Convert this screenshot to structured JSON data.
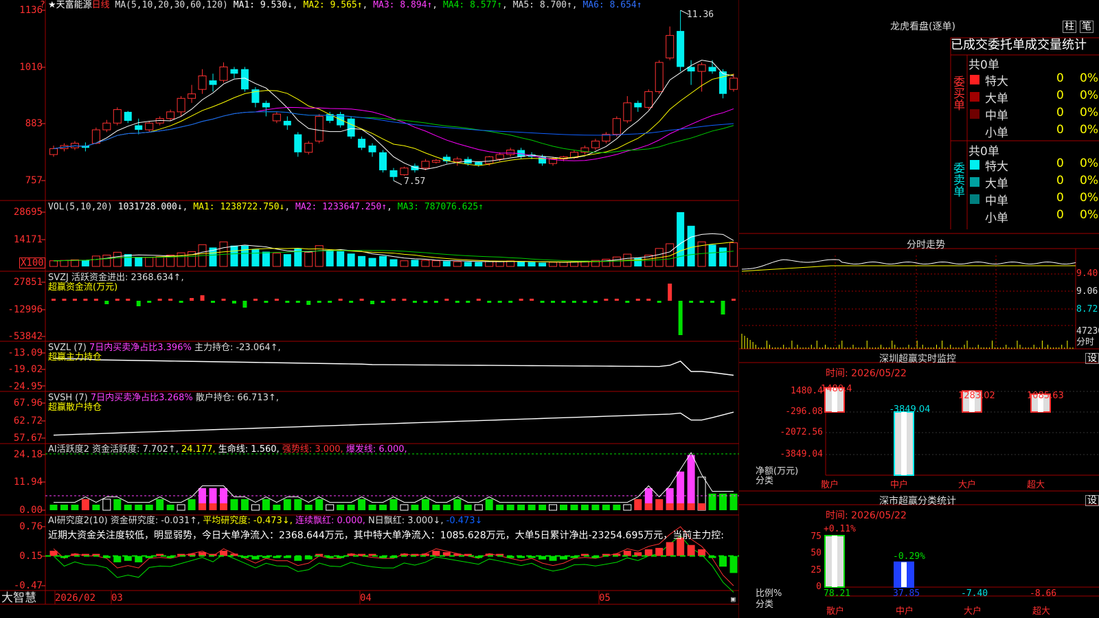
{
  "colors": {
    "up": "#ff3232",
    "down": "#00f0f0",
    "ma1": "#ffffff",
    "ma2": "#ffff00",
    "ma3": "#ff00ff",
    "ma4": "#00cc00",
    "ma5": "#1060ff",
    "grid": "#a00000",
    "yellow": "#ffff00",
    "magenta": "#ff40ff",
    "green": "#00e000"
  },
  "header": {
    "star_title": "★天富能源",
    "period": "日线",
    "ma_params": "MA(5,10,20,30,60,120)",
    "ma1": "MA1: 9.530↓",
    "ma2": "MA2: 9.565↑",
    "ma3": "MA3: 8.894↑",
    "ma4": "MA4: 8.577↑",
    "ma5": "MA5: 8.700↑",
    "ma6": "MA6: 8.654↑",
    "question": "?"
  },
  "price_axis": [
    "1136",
    "1010",
    "883",
    "757"
  ],
  "annotations": {
    "high": "11.36",
    "low": "7.57"
  },
  "vol_header": {
    "label": "VOL(5,10,20)",
    "value": "1031728.000↓",
    "ma1": "MA1: 1238722.750↓",
    "ma2": "MA2: 1233647.250↑",
    "ma3": "MA3: 787076.625↑"
  },
  "vol_axis": [
    "28695",
    "14171",
    "X100"
  ],
  "svzj": {
    "title": "SVZJ  活跃资金进出: 2368.634↑,",
    "sub": "超赢资金流(万元)",
    "axis": [
      "27851",
      "-12996",
      "-53842"
    ]
  },
  "svzl": {
    "title": "SVZL (7) ",
    "mid": "7日内买卖净占比3.396%",
    "tail": " 主力持仓: -23.064↑,",
    "sub": "超赢主力持仓",
    "axis": [
      "-13.09",
      "-19.02",
      "-24.95"
    ]
  },
  "svsh": {
    "title": "SVSH (7) ",
    "mid": "7日内买卖净占比3.268%",
    "tail": " 散户持仓: 66.713↑,",
    "sub": "超赢散户持仓",
    "axis": [
      "67.96",
      "62.72",
      "57.67"
    ]
  },
  "ai2": {
    "title": "AI活跃度2 资金活跃度: 7.702↑,",
    "p2": "24.177,",
    "p3": "生命线: 1.560,",
    "p4": "强势线: 3.000,",
    "p5": "爆发线: 6.000,",
    "axis": [
      "24.18",
      "11.94",
      "0.00"
    ]
  },
  "ai_r": {
    "title": "AI研究度2(10) 资金研究度: -0.031↑,",
    "p2": "平均研究度: -0.473↓,",
    "p3": "连续飘红: 0.000,",
    "p4": "N日飘红: 3.000↓,",
    "p5": "-0.473↓",
    "axis": [
      "0.76",
      "0.15",
      "-0.47"
    ]
  },
  "commentary": "近期大资金关注度较低，明显弱势，今日大单净流入：2368.644万元，其中特大单净流入：1085.628万元，大单5日累计净出-23254.695万元，当前主力控:",
  "bottom_bar": {
    "brand": "大智慧",
    "d1": "2026/02",
    "d2": "03",
    "d3": "04",
    "d4": "05"
  },
  "right": {
    "lhb_title": "龙虎看盘(逐单)",
    "btn_zhu": "柱",
    "btn_bi": "笔",
    "tabs": "已成交委托单成交量统计",
    "buy_label": "委买单",
    "sell_label": "委卖单",
    "buy_total": "共0单",
    "sell_total": "共0单",
    "buy_rows": [
      {
        "name": "特大",
        "count": "0",
        "pct": "0%",
        "color": "#ff2020"
      },
      {
        "name": "大单",
        "count": "0",
        "pct": "0%",
        "color": "#a00000"
      },
      {
        "name": "中单",
        "count": "0",
        "pct": "0%",
        "color": "#700000"
      },
      {
        "name": "小单",
        "count": "0",
        "pct": "0%",
        "color": ""
      }
    ],
    "sell_rows": [
      {
        "name": "特大",
        "count": "0",
        "pct": "0%",
        "color": "#00f0f0"
      },
      {
        "name": "大单",
        "count": "0",
        "pct": "0%",
        "color": "#00a0a0"
      },
      {
        "name": "中单",
        "count": "0",
        "pct": "0%",
        "color": "#008080"
      },
      {
        "name": "小单",
        "count": "0",
        "pct": "0%",
        "color": ""
      }
    ],
    "intraday_title": "分时走势",
    "intraday_axis": [
      "9.40",
      "9.06",
      "8.72"
    ],
    "intraday_vol_axis": [
      "47230",
      "分时"
    ],
    "sz_title": "深圳超赢实时监控",
    "sz_settings": "设",
    "sz_time": "时间: 2026/05/22",
    "sz_axis": [
      "1480.4",
      "-296.08",
      "-2072.56",
      "-3849.04"
    ],
    "sz_ylabel": "净额(万元)",
    "sz_xlabel": "分类",
    "sz_vals": [
      "1480.4",
      "-3849.04",
      "1283.02",
      "1085.63"
    ],
    "sz_cats": [
      "散户",
      "中户",
      "大户",
      "超大"
    ],
    "sh_title": "深市超赢分类统计",
    "sh_settings": "设",
    "sh_time": "时间: 2026/05/22",
    "sh_axis": [
      "75",
      "50",
      "25",
      "0"
    ],
    "sh_ylabel": "比例%",
    "sh_xlabel": "分类",
    "sh_top": [
      "+0.11%",
      "-0.29%"
    ],
    "sh_vals": [
      "78.21",
      "37.85",
      "-7.40",
      "-8.66"
    ],
    "sh_cats": [
      "散户",
      "中户",
      "大户",
      "超大"
    ]
  },
  "chart_data": [
    {
      "type": "candlestick",
      "title": "★天富能源 日线",
      "ylim": [
        7.3,
        11.6
      ],
      "x_labels": [
        "2026/02",
        "03",
        "04",
        "05"
      ],
      "candles": [
        [
          8.15,
          8.28,
          8.1,
          8.35
        ],
        [
          8.28,
          8.35,
          8.22,
          8.4
        ],
        [
          8.3,
          8.4,
          8.25,
          8.45
        ],
        [
          8.35,
          8.3,
          8.22,
          8.42
        ],
        [
          8.4,
          8.7,
          8.38,
          8.75
        ],
        [
          8.7,
          8.85,
          8.65,
          8.92
        ],
        [
          8.85,
          9.15,
          8.8,
          9.2
        ],
        [
          9.1,
          8.9,
          8.85,
          9.12
        ],
        [
          8.8,
          8.7,
          8.6,
          8.95
        ],
        [
          8.7,
          8.85,
          8.65,
          8.9
        ],
        [
          8.85,
          8.95,
          8.8,
          9.0
        ],
        [
          8.95,
          9.1,
          8.9,
          9.15
        ],
        [
          9.1,
          9.4,
          9.0,
          9.45
        ],
        [
          9.4,
          9.5,
          9.3,
          9.7
        ],
        [
          9.6,
          9.9,
          9.5,
          10.05
        ],
        [
          9.8,
          9.7,
          9.55,
          9.95
        ],
        [
          9.8,
          10.1,
          9.75,
          10.2
        ],
        [
          10.05,
          9.95,
          9.85,
          10.1
        ],
        [
          10.05,
          9.6,
          9.55,
          10.1
        ],
        [
          9.6,
          9.3,
          9.2,
          9.65
        ],
        [
          9.3,
          9.2,
          9.0,
          9.35
        ],
        [
          8.9,
          9.05,
          8.85,
          9.1
        ],
        [
          8.9,
          8.8,
          8.7,
          9.0
        ],
        [
          8.6,
          8.2,
          8.1,
          8.65
        ],
        [
          8.2,
          8.4,
          8.15,
          8.45
        ],
        [
          8.45,
          9.0,
          8.4,
          9.05
        ],
        [
          9.05,
          8.9,
          8.85,
          9.1
        ],
        [
          9.05,
          8.8,
          8.75,
          9.1
        ],
        [
          8.95,
          8.55,
          8.5,
          9.0
        ],
        [
          8.5,
          8.3,
          8.25,
          8.55
        ],
        [
          8.35,
          8.2,
          8.1,
          8.4
        ],
        [
          8.2,
          7.8,
          7.75,
          8.25
        ],
        [
          7.8,
          7.65,
          7.57,
          7.85
        ],
        [
          7.7,
          7.85,
          7.68,
          7.88
        ],
        [
          7.9,
          7.8,
          7.75,
          7.95
        ],
        [
          7.85,
          8.0,
          7.8,
          8.05
        ],
        [
          7.98,
          8.02,
          7.95,
          8.05
        ],
        [
          8.1,
          8.0,
          7.95,
          8.15
        ],
        [
          8.0,
          8.05,
          7.9,
          8.1
        ],
        [
          8.05,
          7.95,
          7.9,
          8.1
        ],
        [
          7.98,
          7.92,
          7.88,
          8.0
        ],
        [
          7.95,
          8.1,
          7.9,
          8.12
        ],
        [
          8.05,
          8.15,
          8.0,
          8.2
        ],
        [
          8.15,
          8.25,
          8.1,
          8.3
        ],
        [
          8.25,
          8.1,
          8.05,
          8.3
        ],
        [
          8.15,
          8.1,
          8.05,
          8.2
        ],
        [
          8.1,
          7.95,
          7.9,
          8.15
        ],
        [
          7.95,
          8.05,
          7.9,
          8.1
        ],
        [
          8.05,
          8.1,
          8.0,
          8.12
        ],
        [
          8.08,
          8.2,
          8.05,
          8.25
        ],
        [
          8.2,
          8.3,
          8.15,
          8.35
        ],
        [
          8.3,
          8.45,
          8.25,
          8.5
        ],
        [
          8.45,
          8.6,
          8.4,
          8.65
        ],
        [
          8.6,
          8.95,
          8.55,
          9.0
        ],
        [
          8.9,
          9.3,
          8.85,
          9.45
        ],
        [
          9.3,
          9.2,
          9.1,
          9.35
        ],
        [
          9.2,
          9.55,
          9.15,
          9.6
        ],
        [
          9.55,
          10.2,
          9.5,
          10.25
        ],
        [
          10.3,
          10.8,
          10.25,
          11.0
        ],
        [
          10.9,
          10.1,
          10.0,
          11.36
        ],
        [
          10.1,
          10.0,
          9.7,
          10.25
        ],
        [
          10.0,
          10.15,
          9.55,
          10.2
        ],
        [
          10.1,
          10.0,
          9.95,
          10.25
        ],
        [
          10.0,
          9.5,
          9.4,
          10.05
        ],
        [
          9.6,
          9.85,
          9.55,
          9.95
        ]
      ]
    },
    {
      "type": "bar",
      "title": "VOL(5,10,20)",
      "ylabel": "X100",
      "ylim": [
        0,
        30000
      ],
      "values": [
        3000,
        3200,
        3500,
        3300,
        5500,
        6000,
        7500,
        6500,
        5000,
        4800,
        5200,
        6000,
        7200,
        7800,
        11500,
        10000,
        13000,
        11000,
        11000,
        9000,
        7800,
        7000,
        6500,
        9500,
        7500,
        11000,
        8500,
        8000,
        6800,
        5500,
        4500,
        5500,
        3800,
        3000,
        3500,
        3200,
        3000,
        2800,
        2500,
        2400,
        2300,
        2600,
        2700,
        2900,
        2400,
        2300,
        2000,
        2200,
        2300,
        2600,
        2900,
        3200,
        3800,
        5000,
        6500,
        4500,
        6000,
        9500,
        12000,
        28695,
        21500,
        13000,
        11500,
        10000,
        12500
      ],
      "ups": [
        1,
        1,
        1,
        0,
        1,
        1,
        1,
        0,
        0,
        1,
        1,
        1,
        1,
        1,
        1,
        0,
        1,
        0,
        0,
        0,
        0,
        1,
        0,
        0,
        1,
        1,
        0,
        0,
        0,
        0,
        0,
        0,
        0,
        1,
        0,
        1,
        1,
        0,
        1,
        0,
        0,
        1,
        1,
        1,
        0,
        0,
        0,
        1,
        1,
        1,
        1,
        1,
        1,
        1,
        1,
        0,
        1,
        1,
        1,
        0,
        0,
        1,
        0,
        0,
        1
      ]
    }
  ]
}
